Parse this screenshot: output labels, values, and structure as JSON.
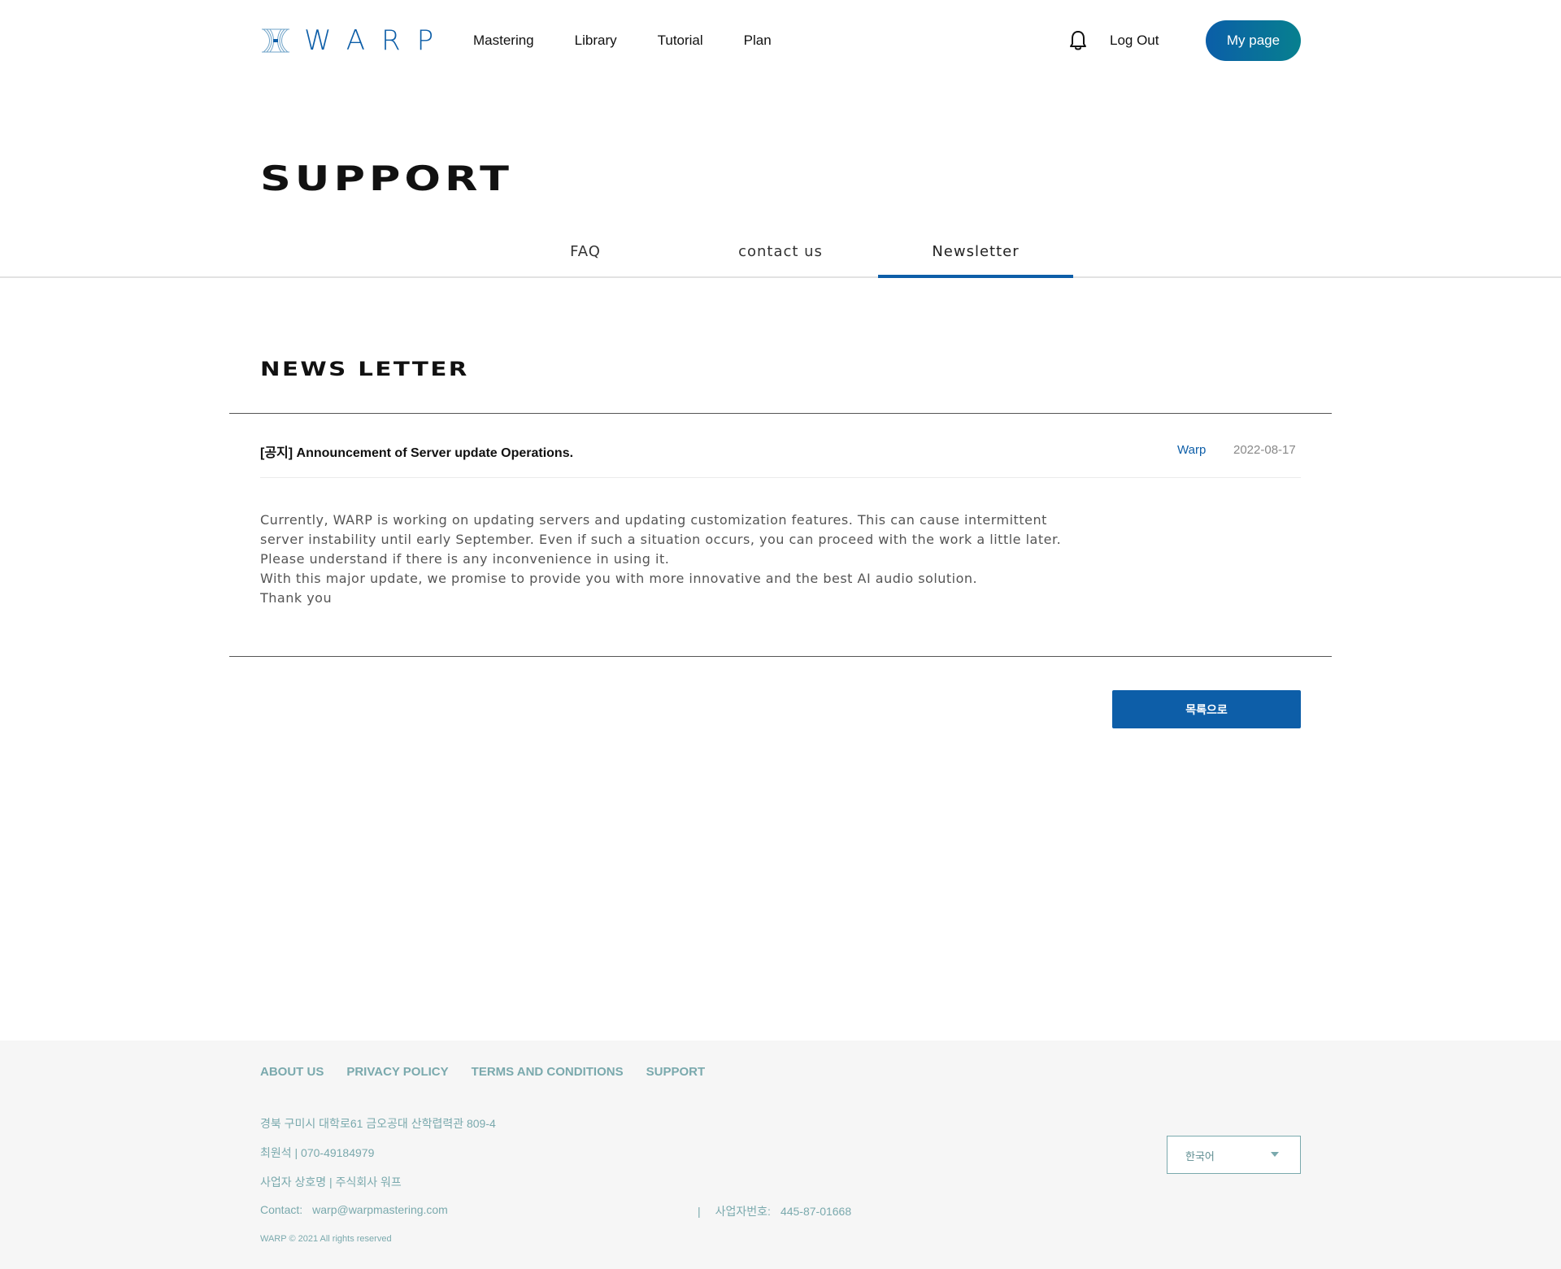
{
  "header": {
    "logo_text": "WARP",
    "nav": [
      "Mastering",
      "Library",
      "Tutorial",
      "Plan"
    ],
    "logout_label": "Log Out",
    "mypage_label": "My page",
    "icons": [
      "bell-icon",
      "warp-logo-icon"
    ]
  },
  "page": {
    "title": "SUPPORT",
    "tabs": [
      "FAQ",
      "contact us",
      "Newsletter"
    ],
    "active_tab": "Newsletter"
  },
  "section": {
    "title": "NEWS LETTER"
  },
  "post": {
    "title": "[공지] Announcement of Server update Operations.",
    "author": "Warp",
    "date": "2022-08-17",
    "body": [
      "Currently, WARP is working on updating servers and updating customization features. This can cause intermittent",
      "server instability until early September. Even if such a situation occurs, you can proceed with the work a little later.",
      "Please understand if there is any inconvenience in using it.",
      "With this major update, we promise to provide you with more innovative and the best AI audio solution.",
      "Thank you"
    ]
  },
  "list_button_label": "목록으로",
  "footer": {
    "links": [
      "ABOUT US",
      "PRIVACY POLICY",
      "TERMS AND CONDITIONS",
      "SUPPORT"
    ],
    "address": "경북 구미시 대학로61 금오공대 산학렵력관 809-4",
    "ceo": "최원석 | 070-49184979",
    "company": "사업자 상호명 | 주식회사 워프",
    "contact_label": "Contact:",
    "contact_email": "warp@warpmastering.com",
    "biz_sep": "|",
    "biz_label": "사업자번호:",
    "biz_number": "445-87-01668",
    "copyright": "WARP © 2021 All rights reserved",
    "language": "한국어"
  },
  "colors": {
    "brand_blue": "#0d5ea8",
    "footer_teal": "#7aa9ad"
  }
}
